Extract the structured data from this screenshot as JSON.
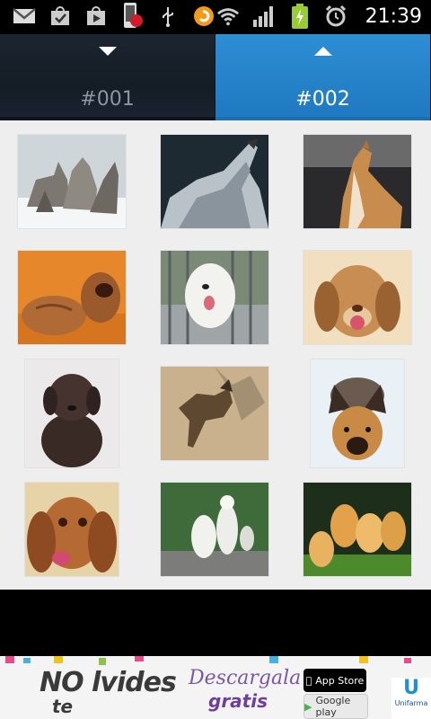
{
  "status_bar": {
    "time": "21:39",
    "icons": [
      "gmail-icon",
      "download-icon",
      "play-store-icon",
      "phone-icon",
      "notification-dot-icon",
      "usb-icon",
      "rss-icon",
      "wifi-icon",
      "signal-icon",
      "battery-charging-icon",
      "alarm-icon"
    ]
  },
  "tabs": [
    {
      "label": "#001",
      "active": false
    },
    {
      "label": "#002",
      "active": true
    }
  ],
  "gallery": {
    "thumbnails": [
      {
        "name": "thumb-wolves-howling-snow",
        "subject": "wolves howling in snow"
      },
      {
        "name": "thumb-wolf-howling",
        "subject": "wolf howling"
      },
      {
        "name": "thumb-dog-howling-car",
        "subject": "small dog howling in car"
      },
      {
        "name": "thumb-sharpei-puppies",
        "subject": "shar-pei puppies"
      },
      {
        "name": "thumb-white-dog-fence",
        "subject": "white dog at fence"
      },
      {
        "name": "thumb-beagle-puppy",
        "subject": "beagle puppy smiling"
      },
      {
        "name": "thumb-chocolate-lab",
        "subject": "chocolate labrador puppy"
      },
      {
        "name": "thumb-brindle-dog",
        "subject": "brindle dog on sand"
      },
      {
        "name": "thumb-german-shepherd",
        "subject": "german shepherd puppy"
      },
      {
        "name": "thumb-cocker-spaniel",
        "subject": "cocker spaniel"
      },
      {
        "name": "thumb-white-dogs-standing",
        "subject": "white dogs standing"
      },
      {
        "name": "thumb-golden-puppies",
        "subject": "golden retriever puppies"
      }
    ]
  },
  "ad": {
    "brand_main": "NO lvides",
    "brand_te": "te",
    "descarga": "Descargala",
    "gratis": "gratis",
    "app_store": "App Store",
    "google_play": "Google play",
    "sponsor": "Unifarma",
    "colors": {
      "purple": "#6c3f9c",
      "blue": "#1f8fd8"
    }
  }
}
